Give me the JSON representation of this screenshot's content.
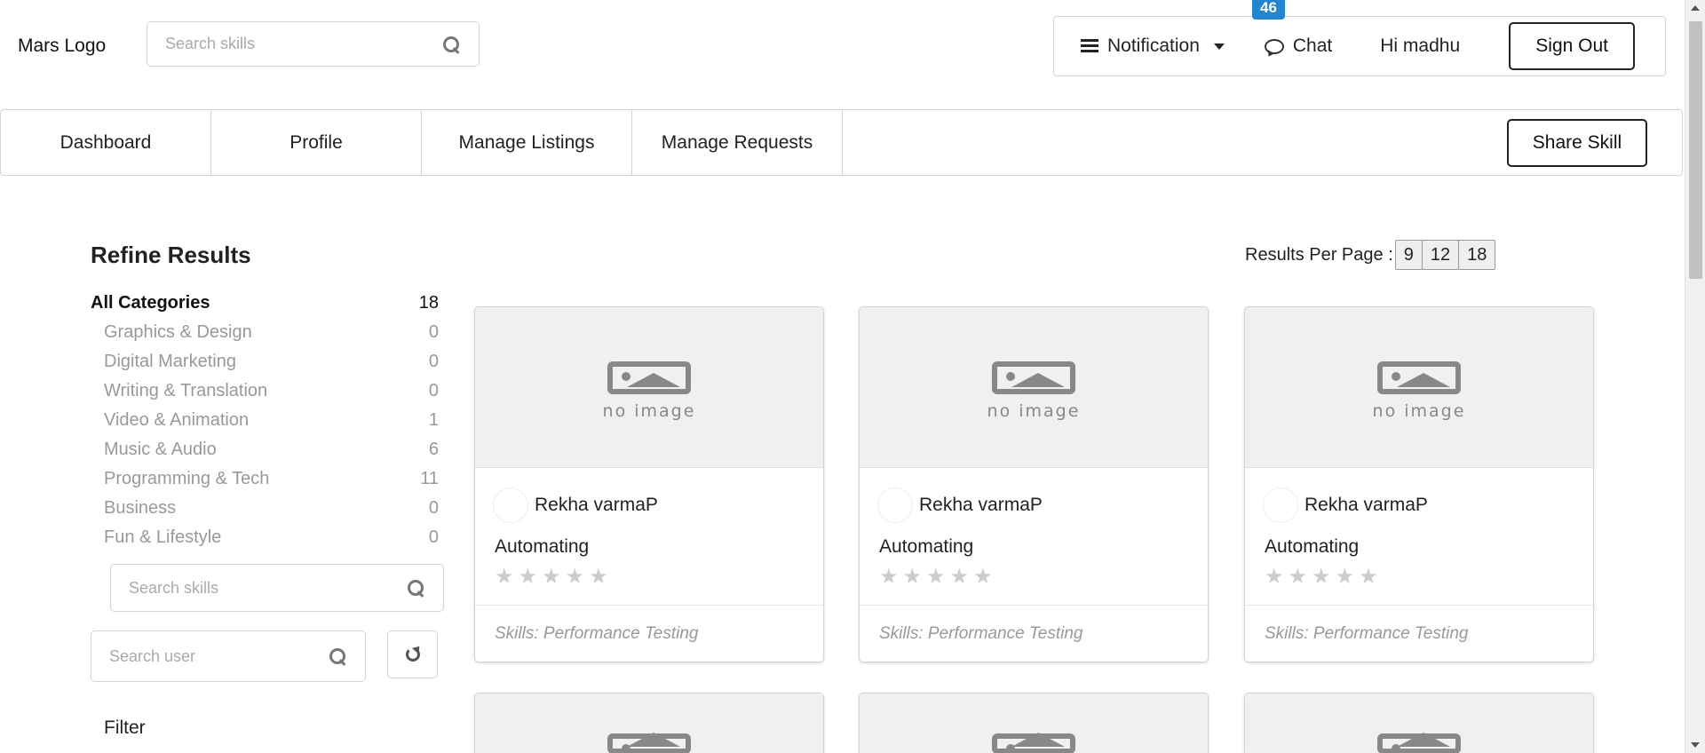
{
  "header": {
    "logo": "Mars Logo",
    "search_placeholder": "Search skills",
    "notification_label": "Notification",
    "notification_count": "46",
    "chat_label": "Chat",
    "greeting": "Hi madhu",
    "signout_label": "Sign Out"
  },
  "nav": {
    "tabs": [
      "Dashboard",
      "Profile",
      "Manage Listings",
      "Manage Requests"
    ],
    "share_label": "Share Skill"
  },
  "sidebar": {
    "title": "Refine Results",
    "categories": [
      {
        "name": "All Categories",
        "count": "18"
      },
      {
        "name": "Graphics & Design",
        "count": "0"
      },
      {
        "name": "Digital Marketing",
        "count": "0"
      },
      {
        "name": "Writing & Translation",
        "count": "0"
      },
      {
        "name": "Video & Animation",
        "count": "1"
      },
      {
        "name": "Music & Audio",
        "count": "6"
      },
      {
        "name": "Programming & Tech",
        "count": "11"
      },
      {
        "name": "Business",
        "count": "0"
      },
      {
        "name": "Fun & Lifestyle",
        "count": "0"
      }
    ],
    "skill_search_placeholder": "Search skills",
    "user_search_placeholder": "Search user",
    "filter_label": "Filter"
  },
  "results": {
    "per_page_label": "Results Per Page :",
    "per_page_options": [
      "9",
      "12",
      "18"
    ],
    "no_image_text": "no image",
    "cards": [
      {
        "seller": "Rekha varmaP",
        "title": "Automating",
        "skills": "Skills: Performance Testing",
        "rating": 0
      },
      {
        "seller": "Rekha varmaP",
        "title": "Automating",
        "skills": "Skills: Performance Testing",
        "rating": 0
      },
      {
        "seller": "Rekha varmaP",
        "title": "Automating",
        "skills": "Skills: Performance Testing",
        "rating": 0
      }
    ]
  },
  "colors": {
    "badge": "#2185d0",
    "border": "#d4d4d5",
    "muted_text": "#999999"
  }
}
